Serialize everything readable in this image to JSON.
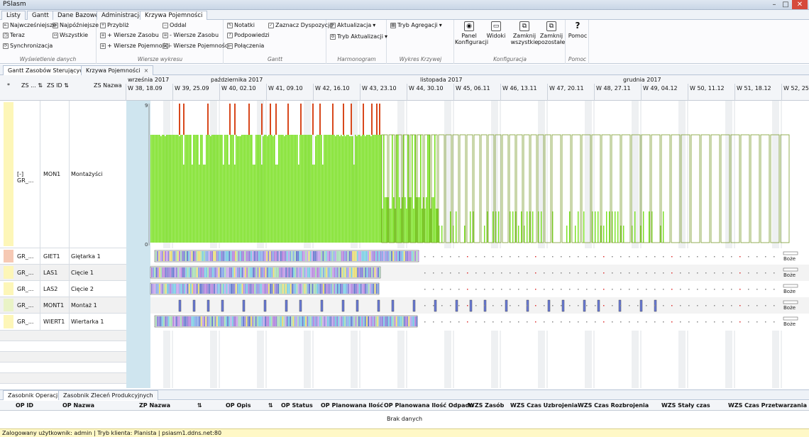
{
  "app": {
    "title": "PSlasm"
  },
  "menu_tabs": [
    "Listy",
    "Gantt",
    "Dane Bazowe",
    "Administracja",
    "Krzywa Pojemności"
  ],
  "ribbon": {
    "groups": [
      {
        "caption": "Wyświetlenie danych",
        "items": [
          "Najwcześniejsze",
          "Najpóźniejsze",
          "Teraz",
          "Wszystkie",
          "Synchronizacja"
        ]
      },
      {
        "caption": "Wiersze wykresu",
        "items": [
          "Przybliż",
          "Oddal",
          "+ Wiersze Zasobu",
          "- Wiersze Zasobu",
          "+ Wiersze Pojemności",
          "- Wiersze Pojemności"
        ]
      },
      {
        "caption": "Gantt",
        "items": [
          "Notatki",
          "Podpowiedzi",
          "Połączenia",
          "Zaznacz Dyspozycję"
        ]
      },
      {
        "caption": "Harmonogram",
        "items": [
          "Aktualizacja",
          "Tryb Aktualizacji"
        ]
      },
      {
        "caption": "Wykres Krzywej",
        "items": [
          "Tryb Agregacji"
        ]
      },
      {
        "caption": "Konfiguracja",
        "items": [
          "Panel Konfiguracji",
          "Widoki",
          "Zamknij wszystkie",
          "Zamknij pozostałe"
        ]
      },
      {
        "caption": "Pomoc",
        "items": [
          "Pomoc"
        ]
      }
    ]
  },
  "doc_tabs": [
    "Gantt Zasobów Sterujących",
    "Krzywa Pojemności"
  ],
  "gantt": {
    "columns": [
      "ZS ...",
      "ZS ID",
      "ZS Nazwa"
    ],
    "star": "*",
    "months": [
      {
        "label": "września 2017"
      },
      {
        "label": "października 2017"
      },
      {
        "label": "listopada 2017"
      },
      {
        "label": "grudnia 2017"
      }
    ],
    "weeks": [
      "W 38, 18.09",
      "W 39, 25.09",
      "W 40, 02.10",
      "W 41, 09.10",
      "W 42, 16.10",
      "W 43, 23.10",
      "W 44, 30.10",
      "W 45, 06.11",
      "W 46, 13.11",
      "W 47, 20.11",
      "W 48, 27.11",
      "W 49, 04.12",
      "W 50, 11.12",
      "W 51, 18.12",
      "W 52, 25.12"
    ],
    "axis": {
      "max": "9",
      "min": "0"
    },
    "rows": [
      {
        "group": "[-] GR_...",
        "id": "MON1",
        "name": "Montażyści",
        "flag": "#fdf6b8"
      },
      {
        "group": "GR_...",
        "id": "GIET1",
        "name": "Giętarka 1",
        "flag": "#f6c9b4"
      },
      {
        "group": "GR_...",
        "id": "LAS1",
        "name": "Cięcie 1",
        "flag": "#fdf6b8"
      },
      {
        "group": "GR_...",
        "id": "LAS2",
        "name": "Cięcie 2",
        "flag": "#fdf6b8"
      },
      {
        "group": "GR_...",
        "id": "MONT1",
        "name": "Montaż 1",
        "flag": "#e9f3c6"
      },
      {
        "group": "GR_...",
        "id": "WIERT1",
        "name": "Wiertarka 1",
        "flag": "#fdf6b8"
      }
    ],
    "boze_label": "Boże",
    "colors": {
      "capacity": "#77e01e",
      "overload": "#d8481c",
      "outline": "#7a9c2d"
    }
  },
  "bottom_tabs": [
    "Zasobnik Operacji",
    "Zasobnik Zleceń Produkcyjnych"
  ],
  "grid": {
    "headers": [
      "OP ID",
      "OP Nazwa",
      "ZP Nazwa",
      "OP Opis",
      "OP Status",
      "OP Planowana Ilość",
      "OP Planowana Ilość Odpadu",
      "WZS Zasób",
      "WZS Czas Uzbrojenia",
      "WZS Czas Rozbrojenia",
      "WZS Stały czas",
      "WZS Czas Przetwarzania"
    ],
    "empty": "Brak danych"
  },
  "status": "Zalogowany użytkownik: admin | Tryb klienta: Planista | psiasm1.ddns.net:80"
}
